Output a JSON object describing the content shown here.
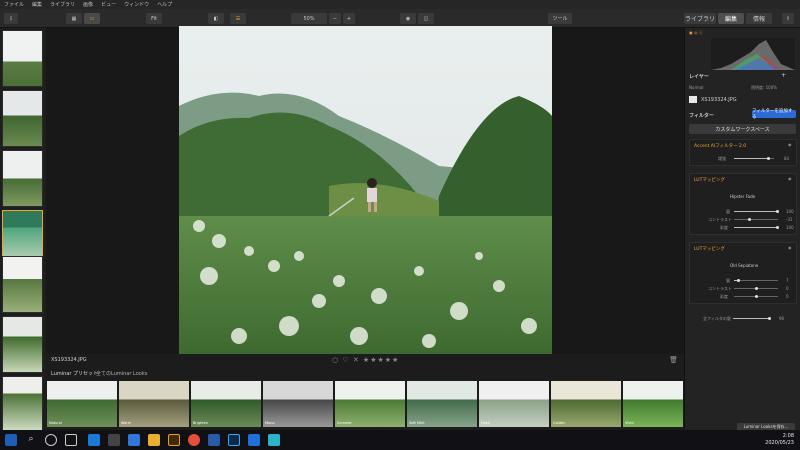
{
  "menu": [
    "ファイル",
    "編集",
    "ライブラリ",
    "画像",
    "ビュー",
    "ウィンドウ",
    "ヘルプ"
  ],
  "toolbar": {
    "zoom_fit": "Fit",
    "zoom_value": "50%",
    "zoom_out": "−",
    "zoom_in": "+",
    "tools_label": "ツール",
    "tabs": {
      "library": "ライブラリ",
      "edit": "編集",
      "info": "情報"
    }
  },
  "photo": {
    "filename": "XS193324.JPG"
  },
  "rating": {
    "icons": "○ ♡ ✕ ★★★★★"
  },
  "presets": {
    "title": "Luminar プリセット",
    "category": "全てのLuminar Looks",
    "items": [
      "Natural",
      "Warm",
      "Brighten",
      "Mono",
      "Summer",
      "Soft Mint",
      "Haze",
      "Golden",
      "Vivid"
    ]
  },
  "right_panel": {
    "layers_label": "レイヤー",
    "blend_mode": "Normal",
    "opacity": "透明度: 100%",
    "layer_name": "XS193324.JPG",
    "filters_label": "フィルター",
    "add_filter": "フィルターを追加する",
    "workspace": "カスタムワークスペース",
    "sections": [
      {
        "title": "Accent AIフィルター 2.0",
        "sliders": [
          {
            "label": "増強",
            "value": "84"
          }
        ]
      },
      {
        "title": "LUTマッピング",
        "lut": "Hipster Fade",
        "sliders": [
          {
            "label": "量",
            "value": "100"
          },
          {
            "label": "コントラスト",
            "value": "-31"
          },
          {
            "label": "彩度",
            "value": "100"
          }
        ]
      },
      {
        "title": "LUTマッピング",
        "lut": "Old Sepiatone",
        "sliders": [
          {
            "label": "量",
            "value": "7"
          },
          {
            "label": "コントラスト",
            "value": "0"
          },
          {
            "label": "彩度",
            "value": "0"
          }
        ]
      }
    ],
    "all_filters_label": "全フィルタの量",
    "all_filters_value": "96",
    "save_look": "Luminar Looksを保存..."
  },
  "taskbar": {
    "time": "2:08",
    "date": "2020/05/23"
  },
  "colors": {
    "accent": "#f1a534",
    "blue": "#2c6bd6"
  }
}
